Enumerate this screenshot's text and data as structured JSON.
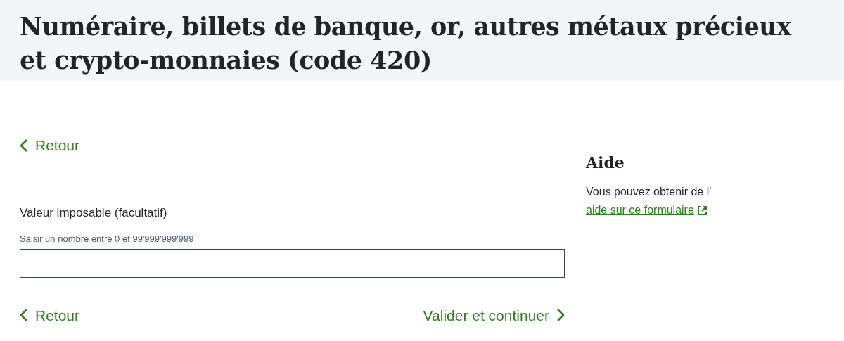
{
  "title": "Numéraire, billets de banque, or, autres métaux précieux et crypto-monnaies (code 420)",
  "back_top": {
    "label": "Retour"
  },
  "field": {
    "label": "Valeur imposable (facultatif)",
    "hint": "Saisir un nombre entre 0 et 99'999'999'999"
  },
  "back_bottom": {
    "label": "Retour"
  },
  "continue": {
    "label": "Valider et continuer"
  },
  "help": {
    "heading": "Aide",
    "text": "Vous pouvez obtenir de l'",
    "link": "aide sur ce formulaire"
  }
}
